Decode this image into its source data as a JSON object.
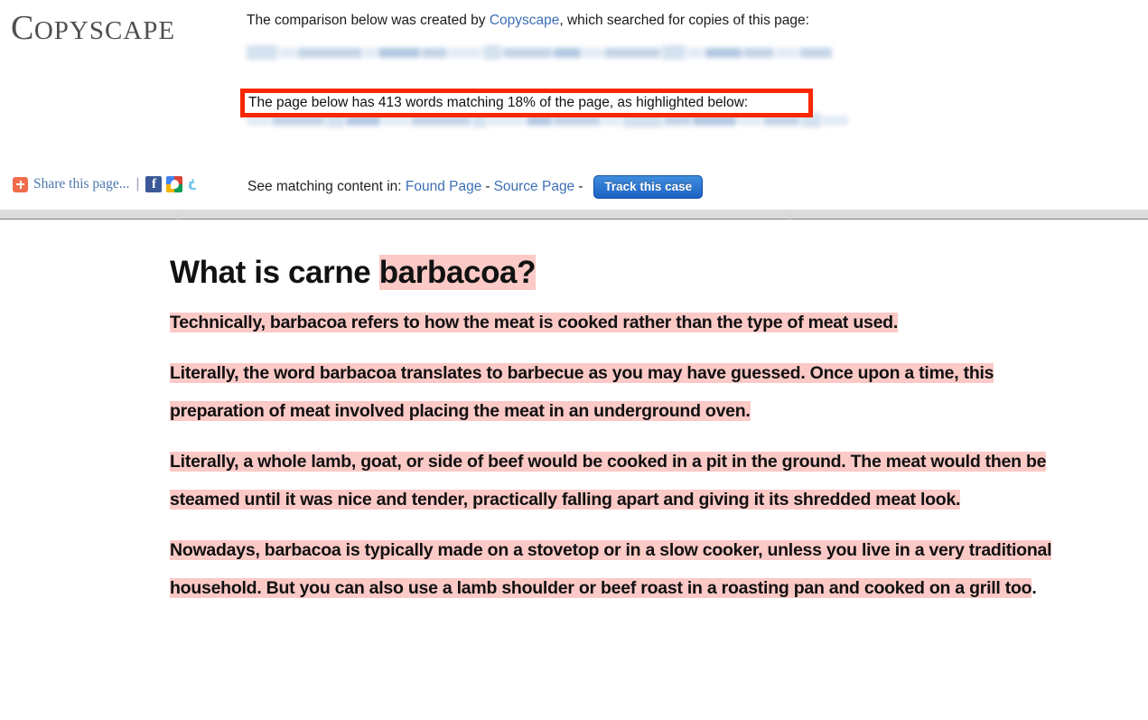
{
  "brand": {
    "logo_cap": "C",
    "logo_rest": "OPYSCAPE",
    "accent_link": "#3d6fb5",
    "annotation_red": "#fa2800",
    "highlight_pink": "#fbc9c6",
    "button_blue": "#1c62c4"
  },
  "header": {
    "intro_before": "The comparison below was created by ",
    "intro_link": "Copyscape",
    "intro_after": ", which searched for copies of this page:",
    "source_url_redacted": "",
    "found_url_redacted": "",
    "match_notice": "The page below has 413 words matching 18% of the page, as highlighted below:",
    "match_words": "413",
    "match_percent": "18%"
  },
  "share": {
    "addthis_icon": "addthis-plus-icon",
    "label": "Share this page...",
    "separator": "|",
    "buttons": [
      {
        "name": "facebook-icon",
        "glyph": "f"
      },
      {
        "name": "google-share-icon",
        "glyph": ""
      },
      {
        "name": "twitter-icon",
        "glyph": "ᵗ"
      }
    ]
  },
  "matching": {
    "prefix": "See matching content in:",
    "found_page_label": "Found Page",
    "dash1": "-",
    "source_page_label": "Source Page",
    "dash2": "-",
    "track_button": "Track this case"
  },
  "document": {
    "heading": {
      "plain": "What is carne ",
      "highlighted": "barbacoa?"
    },
    "paragraphs": [
      {
        "id": "p1",
        "segments": [
          {
            "text": "Technically, barbacoa refers to how the meat is cooked rather than the type of meat used.",
            "highlighted": true
          }
        ]
      },
      {
        "id": "p2",
        "segments": [
          {
            "text": "Literally, the word barbacoa translates to barbecue as you may have guessed. Once upon a time, this preparation of meat involved placing the meat in an underground oven.",
            "highlighted": true
          }
        ]
      },
      {
        "id": "p3",
        "segments": [
          {
            "text": "Literally, a whole lamb, goat, or side of beef would be cooked in a pit in the ground. The meat would then be steamed until it was nice and tender, practically falling apart and giving it its shredded meat look.",
            "highlighted": true
          }
        ]
      },
      {
        "id": "p4",
        "segments": [
          {
            "text": "Nowadays, barbacoa is typically made on a stovetop or in a slow cooker, unless you live in a very traditional household. But you can also use a lamb shoulder or beef roast in a roasting pan and cooked on a grill too",
            "highlighted": true
          },
          {
            "text": ".",
            "highlighted": false
          }
        ]
      }
    ]
  }
}
